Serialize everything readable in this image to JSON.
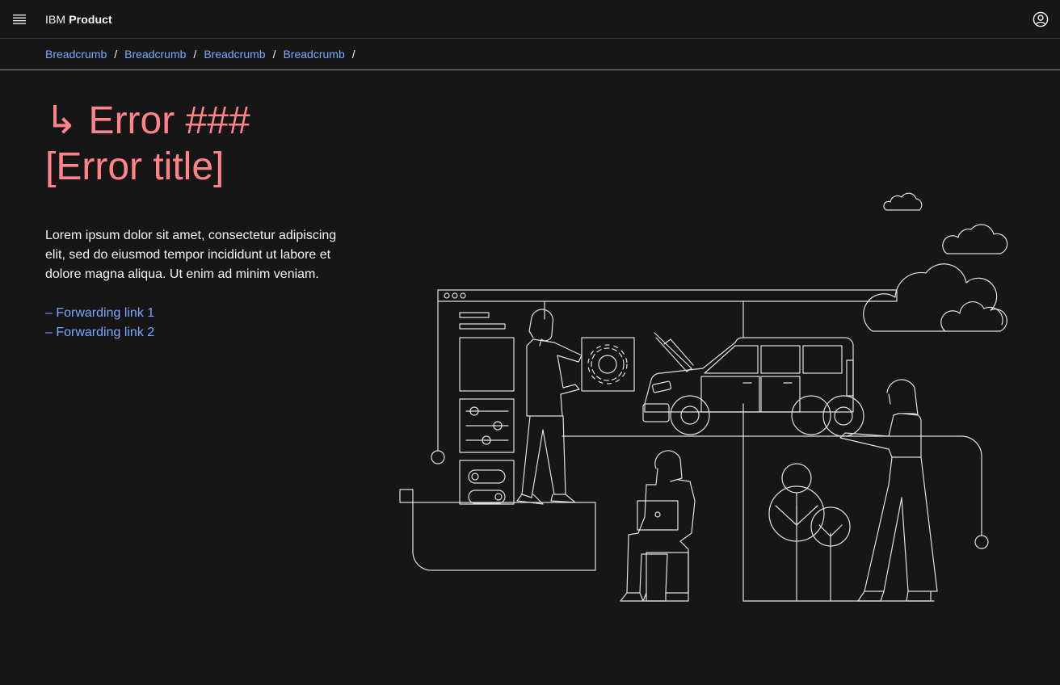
{
  "header": {
    "brand_prefix": "IBM",
    "brand_name": "Product"
  },
  "breadcrumbs": [
    "Breadcrumb",
    "Breadcrumb",
    "Breadcrumb",
    "Breadcrumb"
  ],
  "breadcrumb_separator": "/",
  "error": {
    "title_line1": "↳ Error ###",
    "title_line2": "[Error title]",
    "description": "Lorem ipsum dolor sit amet, consectetur adipiscing elit, sed do eiusmod tempor incididunt ut labore et dolore magna aliqua. Ut enim ad minim veniam."
  },
  "links": [
    "– Forwarding link 1",
    "– Forwarding link 2"
  ],
  "icons": {
    "menu": "hamburger-menu-icon",
    "user": "user-avatar-icon"
  },
  "colors": {
    "background": "#161616",
    "error_title": "#ff8389",
    "link": "#78a9ff",
    "text": "#f4f4f4"
  }
}
